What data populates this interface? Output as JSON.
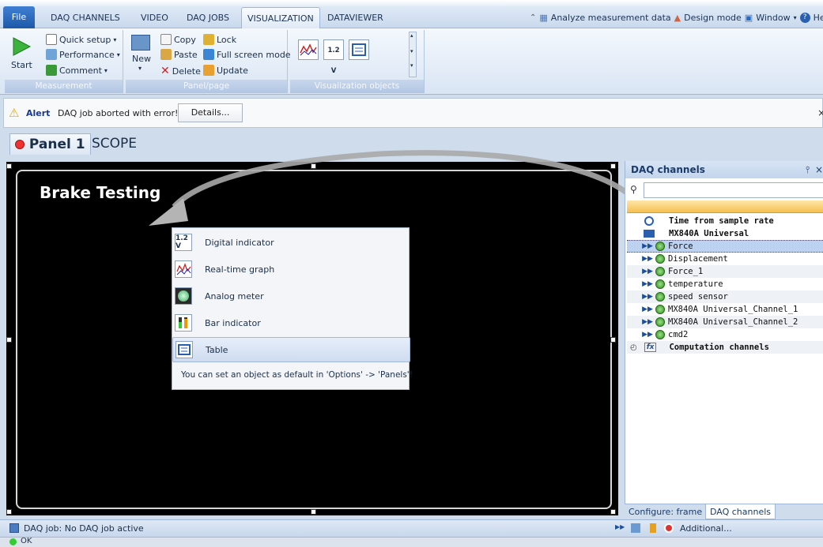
{
  "ribbon_tabs": {
    "file": "File",
    "daq_channels": "DAQ CHANNELS",
    "video": "VIDEO",
    "daq_jobs": "DAQ JOBS",
    "visualization": "VISUALIZATION",
    "dataviewer": "DATAVIEWER"
  },
  "topright": {
    "analyze": "Analyze measurement data",
    "design": "Design mode",
    "window": "Window",
    "help": "Help"
  },
  "ribbon": {
    "measurement": {
      "start": "Start",
      "quick_setup": "Quick setup",
      "performance": "Performance",
      "comment": "Comment",
      "label": "Measurement"
    },
    "panel_page": {
      "new": "New",
      "copy": "Copy",
      "paste": "Paste",
      "delete": "Delete",
      "lock": "Lock",
      "full_screen": "Full screen mode",
      "update": "Update",
      "label": "Panel/page"
    },
    "vis_objects": {
      "digital_label": "1.2 V",
      "label": "Visualization objects"
    }
  },
  "alert": {
    "title": "Alert",
    "message": "DAQ job aborted with error!",
    "details": "Details..."
  },
  "panel_tabs": {
    "panel1": "Panel 1",
    "scope": "SCOPE"
  },
  "canvas": {
    "title": "Brake Testing"
  },
  "popup": {
    "items": [
      {
        "label": "Digital indicator",
        "icon": "1.2 V"
      },
      {
        "label": "Real-time graph",
        "icon": "graph-icon"
      },
      {
        "label": "Analog meter",
        "icon": "meter-icon"
      },
      {
        "label": "Bar indicator",
        "icon": "bar-icon"
      },
      {
        "label": "Table",
        "icon": "table-icon"
      }
    ],
    "hint": "You can set an object as default in 'Options' -> 'Panels'!"
  },
  "daq_panel": {
    "title": "DAQ channels",
    "rows": [
      {
        "label": "Time from sample rate",
        "bold": true
      },
      {
        "label": "MX840A Universal",
        "bold": true
      },
      {
        "label": "Force"
      },
      {
        "label": "Displacement"
      },
      {
        "label": "Force_1"
      },
      {
        "label": "temperature"
      },
      {
        "label": "speed sensor"
      },
      {
        "label": "MX840A Universal_Channel_1"
      },
      {
        "label": "MX840A Universal_Channel_2"
      },
      {
        "label": "cmd2"
      },
      {
        "label": "Computation channels",
        "bold": true
      }
    ]
  },
  "bottom_tabs": {
    "configure": "Configure: frame",
    "daq": "DAQ channels"
  },
  "status": {
    "daq_job": "DAQ job: No DAQ job active",
    "additional": "Additional...",
    "ok": "OK"
  },
  "colors": {
    "accent": "#1e59a8",
    "selected_row": "#bdd2f0",
    "grid_header": "#f5c052"
  }
}
